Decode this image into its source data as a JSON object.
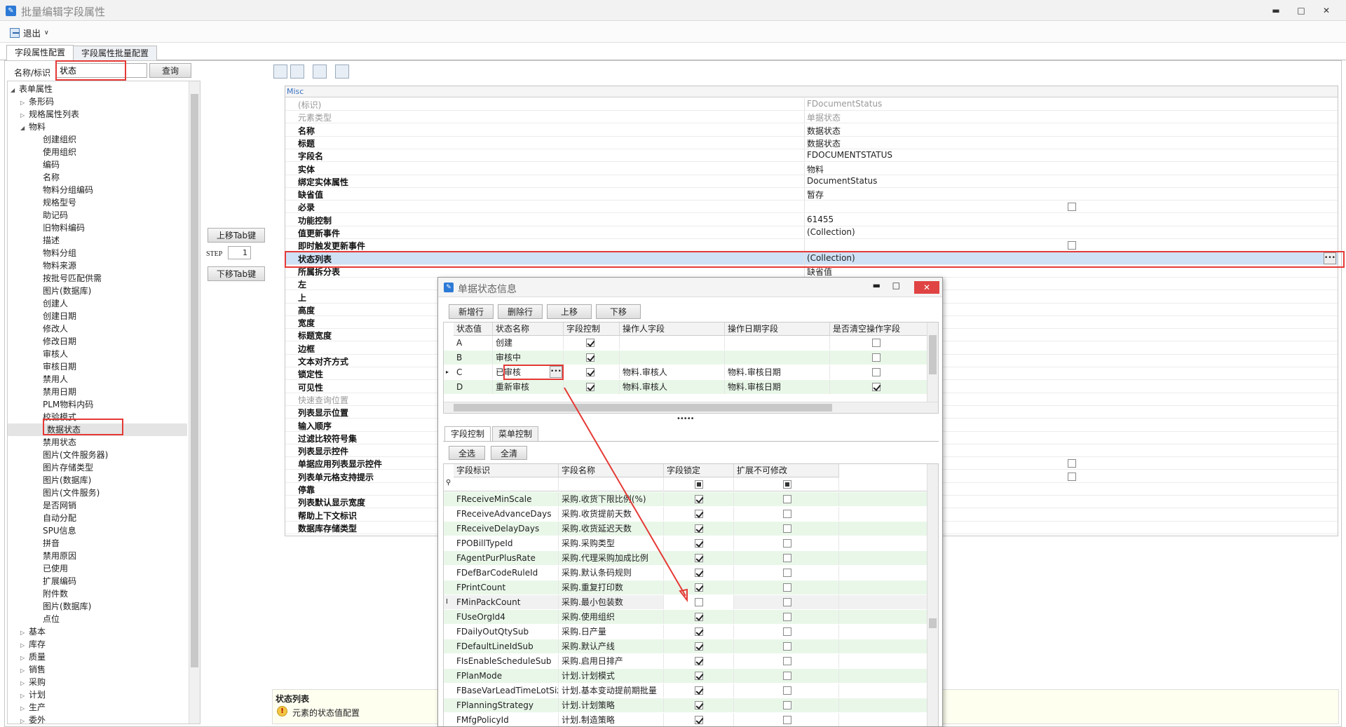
{
  "window": {
    "title": "批量编辑字段属性",
    "min": "▬",
    "max": "□",
    "close": "✕"
  },
  "menu": {
    "exit_label": "退出",
    "exit_arrow": "∨"
  },
  "tabs": [
    {
      "label": "字段属性配置"
    },
    {
      "label": "字段属性批量配置"
    }
  ],
  "search": {
    "label": "名称/标识",
    "value": "状态",
    "query_label": "查询"
  },
  "tree": {
    "root": "表单属性",
    "items": [
      "条形码",
      "规格属性列表",
      "物料",
      "创建组织",
      "使用组织",
      "编码",
      "名称",
      "物料分组编码",
      "规格型号",
      "助记码",
      "旧物料编码",
      "描述",
      "物料分组",
      "物料来源",
      "按批号匹配供需",
      "图片(数据库)",
      "创建人",
      "创建日期",
      "修改人",
      "修改日期",
      "审核人",
      "审核日期",
      "禁用人",
      "禁用日期",
      "PLM物料内码",
      "校验模式",
      "数据状态",
      "禁用状态",
      "图片(文件服务器)",
      "图片存储类型",
      "图片(数据库)",
      "图片(文件服务)",
      "是否网销",
      "自动分配",
      "SPU信息",
      "拼音",
      "禁用原因",
      "已使用",
      "扩展编码",
      "附件数",
      "图片(数据库)",
      "点位",
      "基本",
      "库存",
      "质量",
      "销售",
      "采购",
      "计划",
      "生产",
      "委外"
    ]
  },
  "mid": {
    "up_tab": "上移Tab键",
    "step_label": "STEP",
    "step_value": "1",
    "down_tab": "下移Tab键"
  },
  "grid": {
    "category": "Misc",
    "rows": [
      {
        "name": "(标识)",
        "value": "FDocumentStatus",
        "dim": true
      },
      {
        "name": "元素类型",
        "value": "单据状态",
        "dim": true
      },
      {
        "name": "名称",
        "value": "数据状态"
      },
      {
        "name": "标题",
        "value": "数据状态"
      },
      {
        "name": "字段名",
        "value": "FDOCUMENTSTATUS"
      },
      {
        "name": "实体",
        "value": "物料"
      },
      {
        "name": "绑定实体属性",
        "value": "DocumentStatus"
      },
      {
        "name": "缺省值",
        "value": "暂存"
      },
      {
        "name": "必录",
        "value": "",
        "check": true
      },
      {
        "name": "功能控制",
        "value": "61455"
      },
      {
        "name": "值更新事件",
        "value": "(Collection)"
      },
      {
        "name": "即时触发更新事件",
        "value": "",
        "check": true
      },
      {
        "name": "状态列表",
        "value": "(Collection)",
        "selected": true
      },
      {
        "name": "所属拆分表",
        "value": "缺省值"
      },
      {
        "name": "左",
        "value": ""
      },
      {
        "name": "上",
        "value": ""
      },
      {
        "name": "高度",
        "value": ""
      },
      {
        "name": "宽度",
        "value": ""
      },
      {
        "name": "标题宽度",
        "value": ""
      },
      {
        "name": "边框",
        "value": ""
      },
      {
        "name": "文本对齐方式",
        "value": ""
      },
      {
        "name": "锁定性",
        "value": ""
      },
      {
        "name": "可见性",
        "value": ""
      },
      {
        "name": "快速查询位置",
        "value": "",
        "dim": true
      },
      {
        "name": "列表显示位置",
        "value": ""
      },
      {
        "name": "输入顺序",
        "value": ""
      },
      {
        "name": "过滤比较符号集",
        "value": ""
      },
      {
        "name": "列表显示控件",
        "value": ""
      },
      {
        "name": "单据应用列表显示控件",
        "value": "",
        "check": true
      },
      {
        "name": "列表单元格支持提示",
        "value": "",
        "check": true
      },
      {
        "name": "停靠",
        "value": ""
      },
      {
        "name": "列表默认显示宽度",
        "value": ""
      },
      {
        "name": "帮助上下文标识",
        "value": ""
      },
      {
        "name": "数据库存储类型",
        "value": ""
      }
    ]
  },
  "description": {
    "title": "状态列表",
    "text": "元素的状态值配置"
  },
  "dialog": {
    "title": "单据状态信息",
    "buttons": [
      "新增行",
      "删除行",
      "上移",
      "下移"
    ],
    "status_headers": [
      "状态值",
      "状态名称",
      "字段控制",
      "操作人字段",
      "操作日期字段",
      "是否清空操作字段"
    ],
    "status_rows": [
      {
        "value": "A",
        "name": "创建",
        "field_ctrl": true,
        "operator": "",
        "date": "",
        "clear": false
      },
      {
        "value": "B",
        "name": "审核中",
        "field_ctrl": true,
        "operator": "",
        "date": "",
        "clear": false
      },
      {
        "value": "C",
        "name": "已审核",
        "field_ctrl": true,
        "operator": "物料.审核人",
        "date": "物料.审核日期",
        "clear": false,
        "current": true
      },
      {
        "value": "D",
        "name": "重新审核",
        "field_ctrl": true,
        "operator": "物料.审核人",
        "date": "物料.审核日期",
        "clear": true
      }
    ],
    "splitter": "•••••",
    "inner_tabs": [
      "字段控制",
      "菜单控制"
    ],
    "select_all": "全选",
    "clear_all": "全清",
    "field_headers": [
      "字段标识",
      "字段名称",
      "字段锁定",
      "扩展不可修改"
    ],
    "field_rows": [
      {
        "id": "FReceiveMinScale",
        "name": "采购.收货下限比例(%)",
        "locked": true,
        "ext": false
      },
      {
        "id": "FReceiveAdvanceDays",
        "name": "采购.收货提前天数",
        "locked": true,
        "ext": false
      },
      {
        "id": "FReceiveDelayDays",
        "name": "采购.收货延迟天数",
        "locked": true,
        "ext": false
      },
      {
        "id": "FPOBillTypeId",
        "name": "采购.采购类型",
        "locked": true,
        "ext": false
      },
      {
        "id": "FAgentPurPlusRate",
        "name": "采购.代理采购加成比例",
        "locked": true,
        "ext": false
      },
      {
        "id": "FDefBarCodeRuleId",
        "name": "采购.默认条码规则",
        "locked": true,
        "ext": false
      },
      {
        "id": "FPrintCount",
        "name": "采购.重复打印数",
        "locked": true,
        "ext": false
      },
      {
        "id": "FMinPackCount",
        "name": "采购.最小包装数",
        "locked": false,
        "ext": false,
        "current": true
      },
      {
        "id": "FUseOrgId4",
        "name": "采购.使用组织",
        "locked": true,
        "ext": false
      },
      {
        "id": "FDailyOutQtySub",
        "name": "采购.日产量",
        "locked": true,
        "ext": false
      },
      {
        "id": "FDefaultLineIdSub",
        "name": "采购.默认产线",
        "locked": true,
        "ext": false
      },
      {
        "id": "FIsEnableScheduleSub",
        "name": "采购.启用日排产",
        "locked": true,
        "ext": false
      },
      {
        "id": "FPlanMode",
        "name": "计划.计划模式",
        "locked": true,
        "ext": false
      },
      {
        "id": "FBaseVarLeadTimeLotSize",
        "name": "计划.基本变动提前期批量",
        "locked": true,
        "ext": false
      },
      {
        "id": "FPlanningStrategy",
        "name": "计划.计划策略",
        "locked": true,
        "ext": false
      },
      {
        "id": "FMfgPolicyId",
        "name": "计划.制造策略",
        "locked": true,
        "ext": false
      }
    ]
  },
  "colors": {
    "red": "#e53935",
    "accent": "#2d7ad6",
    "green_row": "#e9f7e9",
    "select_row": "#cfe1f5"
  }
}
